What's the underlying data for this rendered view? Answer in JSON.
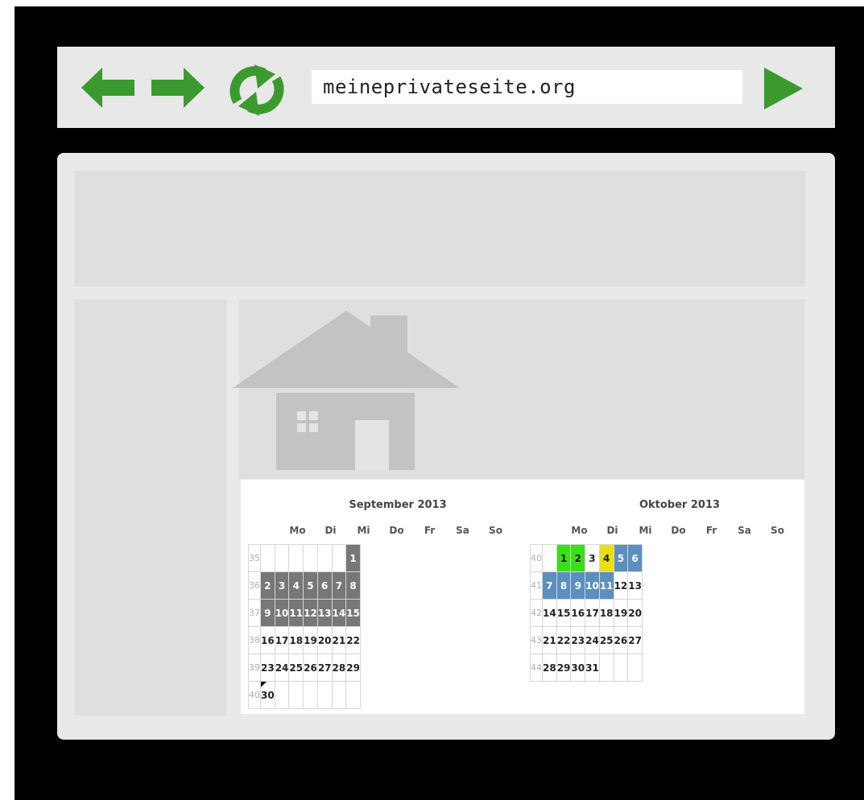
{
  "browser": {
    "url": "meineprivateseite.org",
    "icons": {
      "back": "back-arrow-icon",
      "forward": "forward-arrow-icon",
      "reload": "reload-icon",
      "go": "go-icon"
    },
    "icon_color": "#3a9a2e"
  },
  "calendars": [
    {
      "title": "September 2013",
      "weekdays": [
        "Mo",
        "Di",
        "Mi",
        "Do",
        "Fr",
        "Sa",
        "So"
      ],
      "weeks": [
        {
          "num": "35",
          "days": [
            {
              "d": ""
            },
            {
              "d": ""
            },
            {
              "d": ""
            },
            {
              "d": ""
            },
            {
              "d": ""
            },
            {
              "d": ""
            },
            {
              "d": "1",
              "s": "grey"
            }
          ]
        },
        {
          "num": "36",
          "days": [
            {
              "d": "2",
              "s": "grey"
            },
            {
              "d": "3",
              "s": "grey"
            },
            {
              "d": "4",
              "s": "grey"
            },
            {
              "d": "5",
              "s": "grey"
            },
            {
              "d": "6",
              "s": "grey"
            },
            {
              "d": "7",
              "s": "grey"
            },
            {
              "d": "8",
              "s": "grey"
            }
          ]
        },
        {
          "num": "37",
          "days": [
            {
              "d": "9",
              "s": "grey"
            },
            {
              "d": "10",
              "s": "grey"
            },
            {
              "d": "11",
              "s": "grey"
            },
            {
              "d": "12",
              "s": "grey"
            },
            {
              "d": "13",
              "s": "grey"
            },
            {
              "d": "14",
              "s": "grey"
            },
            {
              "d": "15",
              "s": "grey"
            }
          ]
        },
        {
          "num": "38",
          "days": [
            {
              "d": "16"
            },
            {
              "d": "17"
            },
            {
              "d": "18"
            },
            {
              "d": "19"
            },
            {
              "d": "20"
            },
            {
              "d": "21"
            },
            {
              "d": "22"
            }
          ]
        },
        {
          "num": "39",
          "days": [
            {
              "d": "23"
            },
            {
              "d": "24"
            },
            {
              "d": "25"
            },
            {
              "d": "26"
            },
            {
              "d": "27"
            },
            {
              "d": "28"
            },
            {
              "d": "29"
            }
          ]
        },
        {
          "num": "40",
          "days": [
            {
              "d": "30",
              "s": "marker"
            },
            {
              "d": ""
            },
            {
              "d": ""
            },
            {
              "d": ""
            },
            {
              "d": ""
            },
            {
              "d": ""
            },
            {
              "d": ""
            }
          ]
        }
      ]
    },
    {
      "title": "Oktober 2013",
      "weekdays": [
        "Mo",
        "Di",
        "Mi",
        "Do",
        "Fr",
        "Sa",
        "So"
      ],
      "weeks": [
        {
          "num": "40",
          "days": [
            {
              "d": ""
            },
            {
              "d": "1",
              "s": "green"
            },
            {
              "d": "2",
              "s": "green"
            },
            {
              "d": "3"
            },
            {
              "d": "4",
              "s": "yellow"
            },
            {
              "d": "5",
              "s": "blue"
            },
            {
              "d": "6",
              "s": "blue"
            }
          ]
        },
        {
          "num": "41",
          "days": [
            {
              "d": "7",
              "s": "blue"
            },
            {
              "d": "8",
              "s": "blue"
            },
            {
              "d": "9",
              "s": "blue"
            },
            {
              "d": "10",
              "s": "blue"
            },
            {
              "d": "11",
              "s": "blue"
            },
            {
              "d": "12"
            },
            {
              "d": "13"
            }
          ]
        },
        {
          "num": "42",
          "days": [
            {
              "d": "14"
            },
            {
              "d": "15"
            },
            {
              "d": "16"
            },
            {
              "d": "17"
            },
            {
              "d": "18"
            },
            {
              "d": "19"
            },
            {
              "d": "20"
            }
          ]
        },
        {
          "num": "43",
          "days": [
            {
              "d": "21"
            },
            {
              "d": "22"
            },
            {
              "d": "23"
            },
            {
              "d": "24"
            },
            {
              "d": "25"
            },
            {
              "d": "26"
            },
            {
              "d": "27"
            }
          ]
        },
        {
          "num": "44",
          "days": [
            {
              "d": "28"
            },
            {
              "d": "29"
            },
            {
              "d": "30"
            },
            {
              "d": "31"
            },
            {
              "d": ""
            },
            {
              "d": ""
            },
            {
              "d": ""
            }
          ]
        }
      ]
    }
  ],
  "colors": {
    "booked": "#777777",
    "blue": "#5b8fc0",
    "green": "#39e019",
    "yellow": "#e8e00e"
  }
}
